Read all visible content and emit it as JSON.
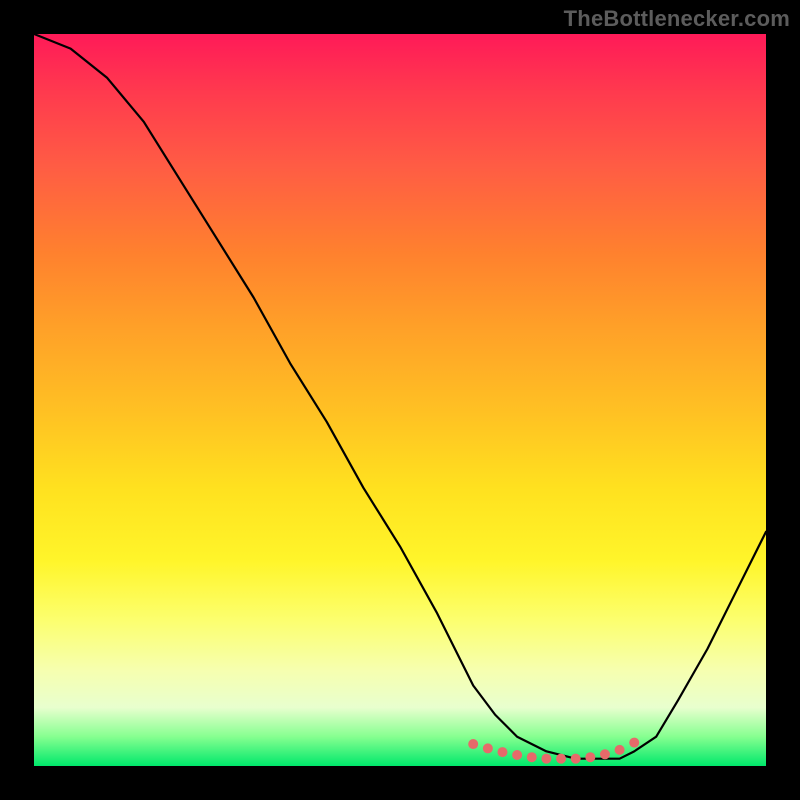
{
  "watermark": "TheBottlenecker.com",
  "chart_data": {
    "type": "line",
    "title": "",
    "xlabel": "",
    "ylabel": "",
    "xlim": [
      0,
      100
    ],
    "ylim": [
      0,
      100
    ],
    "grid": false,
    "series": [
      {
        "name": "bottleneck-curve",
        "x": [
          0,
          5,
          10,
          15,
          20,
          25,
          30,
          35,
          40,
          45,
          50,
          55,
          58,
          60,
          63,
          66,
          70,
          74,
          77,
          80,
          82,
          85,
          88,
          92,
          96,
          100
        ],
        "y": [
          100,
          98,
          94,
          88,
          80,
          72,
          64,
          55,
          47,
          38,
          30,
          21,
          15,
          11,
          7,
          4,
          2,
          1,
          1,
          1,
          2,
          4,
          9,
          16,
          24,
          32
        ]
      }
    ],
    "markers": {
      "name": "optimal-range-dots",
      "color": "#e66a6a",
      "x": [
        60,
        62,
        64,
        66,
        68,
        70,
        72,
        74,
        76,
        78,
        80,
        82
      ],
      "y": [
        3.0,
        2.4,
        1.9,
        1.5,
        1.2,
        1.0,
        1.0,
        1.0,
        1.2,
        1.6,
        2.2,
        3.2
      ]
    },
    "background_gradient": {
      "top": "#ff1a58",
      "mid": "#ffe11f",
      "bottom": "#00e86b"
    }
  }
}
